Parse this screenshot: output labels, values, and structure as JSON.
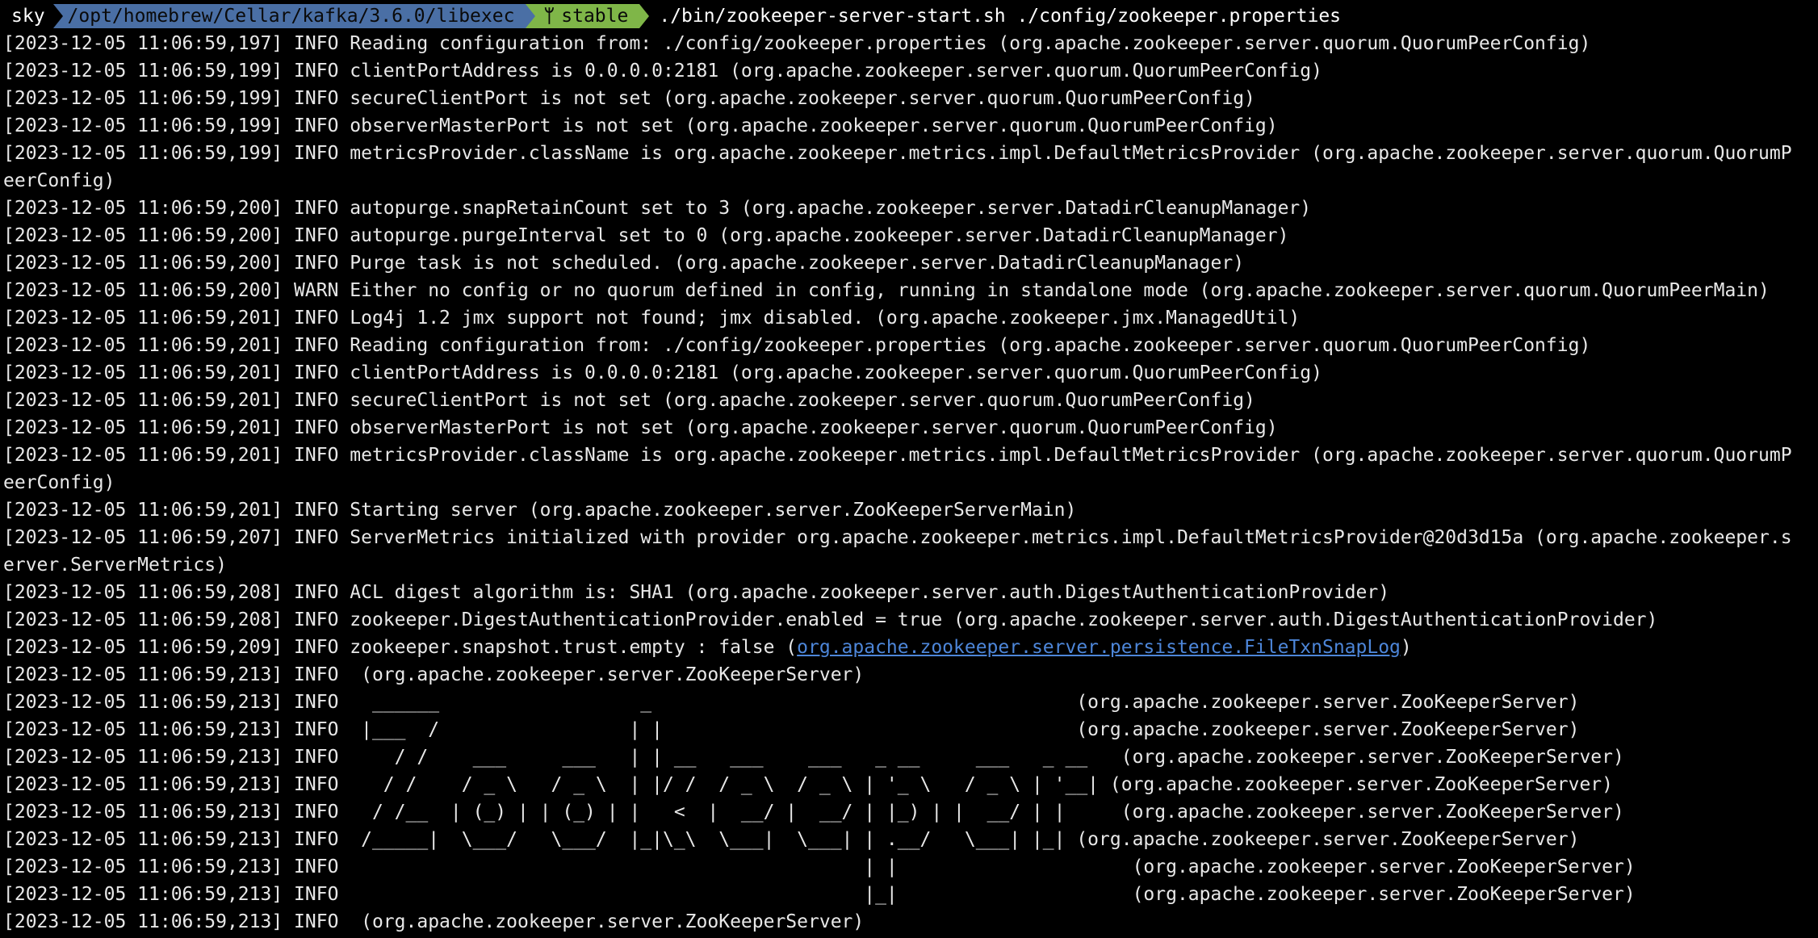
{
  "prompt": {
    "user": "sky",
    "path": "/opt/homebrew/Cellar/kafka/3.6.0/libexec",
    "branch_icon": "git-branch-icon",
    "branch": "stable",
    "command": "./bin/zookeeper-server-start.sh ./config/zookeeper.properties",
    "colors": {
      "path_bg": "#4a6fa5",
      "branch_bg": "#7fb648",
      "link": "#4d86d9"
    }
  },
  "log_lines": [
    {
      "text": "[2023-12-05 11:06:59,197] INFO Reading configuration from: ./config/zookeeper.properties (org.apache.zookeeper.server.quorum.QuorumPeerConfig)"
    },
    {
      "text": "[2023-12-05 11:06:59,199] INFO clientPortAddress is 0.0.0.0:2181 (org.apache.zookeeper.server.quorum.QuorumPeerConfig)"
    },
    {
      "text": "[2023-12-05 11:06:59,199] INFO secureClientPort is not set (org.apache.zookeeper.server.quorum.QuorumPeerConfig)"
    },
    {
      "text": "[2023-12-05 11:06:59,199] INFO observerMasterPort is not set (org.apache.zookeeper.server.quorum.QuorumPeerConfig)"
    },
    {
      "text": "[2023-12-05 11:06:59,199] INFO metricsProvider.className is org.apache.zookeeper.metrics.impl.DefaultMetricsProvider (org.apache.zookeeper.server.quorum.QuorumP"
    },
    {
      "text": "eerConfig)"
    },
    {
      "text": "[2023-12-05 11:06:59,200] INFO autopurge.snapRetainCount set to 3 (org.apache.zookeeper.server.DatadirCleanupManager)"
    },
    {
      "text": "[2023-12-05 11:06:59,200] INFO autopurge.purgeInterval set to 0 (org.apache.zookeeper.server.DatadirCleanupManager)"
    },
    {
      "text": "[2023-12-05 11:06:59,200] INFO Purge task is not scheduled. (org.apache.zookeeper.server.DatadirCleanupManager)"
    },
    {
      "text": "[2023-12-05 11:06:59,200] WARN Either no config or no quorum defined in config, running in standalone mode (org.apache.zookeeper.server.quorum.QuorumPeerMain)"
    },
    {
      "text": "[2023-12-05 11:06:59,201] INFO Log4j 1.2 jmx support not found; jmx disabled. (org.apache.zookeeper.jmx.ManagedUtil)"
    },
    {
      "text": "[2023-12-05 11:06:59,201] INFO Reading configuration from: ./config/zookeeper.properties (org.apache.zookeeper.server.quorum.QuorumPeerConfig)"
    },
    {
      "text": "[2023-12-05 11:06:59,201] INFO clientPortAddress is 0.0.0.0:2181 (org.apache.zookeeper.server.quorum.QuorumPeerConfig)"
    },
    {
      "text": "[2023-12-05 11:06:59,201] INFO secureClientPort is not set (org.apache.zookeeper.server.quorum.QuorumPeerConfig)"
    },
    {
      "text": "[2023-12-05 11:06:59,201] INFO observerMasterPort is not set (org.apache.zookeeper.server.quorum.QuorumPeerConfig)"
    },
    {
      "text": "[2023-12-05 11:06:59,201] INFO metricsProvider.className is org.apache.zookeeper.metrics.impl.DefaultMetricsProvider (org.apache.zookeeper.server.quorum.QuorumP"
    },
    {
      "text": "eerConfig)"
    },
    {
      "text": "[2023-12-05 11:06:59,201] INFO Starting server (org.apache.zookeeper.server.ZooKeeperServerMain)"
    },
    {
      "text": "[2023-12-05 11:06:59,207] INFO ServerMetrics initialized with provider org.apache.zookeeper.metrics.impl.DefaultMetricsProvider@20d3d15a (org.apache.zookeeper.s"
    },
    {
      "text": "erver.ServerMetrics)"
    },
    {
      "text": "[2023-12-05 11:06:59,208] INFO ACL digest algorithm is: SHA1 (org.apache.zookeeper.server.auth.DigestAuthenticationProvider)"
    },
    {
      "text": "[2023-12-05 11:06:59,208] INFO zookeeper.DigestAuthenticationProvider.enabled = true (org.apache.zookeeper.server.auth.DigestAuthenticationProvider)"
    },
    {
      "text": "[2023-12-05 11:06:59,209] INFO zookeeper.snapshot.trust.empty : false (",
      "link": "org.apache.zookeeper.server.persistence.FileTxnSnapLog",
      "after": ")"
    },
    {
      "text": "[2023-12-05 11:06:59,213] INFO  (org.apache.zookeeper.server.ZooKeeperServer)"
    },
    {
      "text": "[2023-12-05 11:06:59,213] INFO   ______                  _                                      (org.apache.zookeeper.server.ZooKeeperServer)"
    },
    {
      "text": "[2023-12-05 11:06:59,213] INFO  |___  /                 | |                                     (org.apache.zookeeper.server.ZooKeeperServer)"
    },
    {
      "text": "[2023-12-05 11:06:59,213] INFO     / /    ___     ___   | | __   ___    ___   _ __     ___   _ __   (org.apache.zookeeper.server.ZooKeeperServer)"
    },
    {
      "text": "[2023-12-05 11:06:59,213] INFO    / /    / _ \\   / _ \\  | |/ /  / _ \\  / _ \\ | '_ \\   / _ \\ | '__| (org.apache.zookeeper.server.ZooKeeperServer)"
    },
    {
      "text": "[2023-12-05 11:06:59,213] INFO   / /__  | (_) | | (_) | |   <  |  __/ |  __/ | |_) | |  __/ | |     (org.apache.zookeeper.server.ZooKeeperServer)"
    },
    {
      "text": "[2023-12-05 11:06:59,213] INFO  /_____|  \\___/   \\___/  |_|\\_\\  \\___|  \\___| | .__/   \\___| |_| (org.apache.zookeeper.server.ZooKeeperServer)"
    },
    {
      "text": "[2023-12-05 11:06:59,213] INFO                                               | |                     (org.apache.zookeeper.server.ZooKeeperServer)"
    },
    {
      "text": "[2023-12-05 11:06:59,213] INFO                                               |_|                     (org.apache.zookeeper.server.ZooKeeperServer)"
    },
    {
      "text": "[2023-12-05 11:06:59,213] INFO  (org.apache.zookeeper.server.ZooKeeperServer)"
    }
  ]
}
